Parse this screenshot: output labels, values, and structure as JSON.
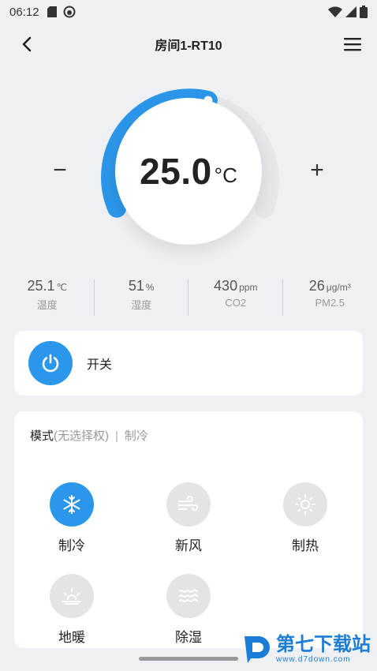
{
  "status_bar": {
    "time": "06:12"
  },
  "header": {
    "title": "房间1-RT10"
  },
  "dial": {
    "setpoint": "25.0",
    "unit": "°C",
    "minus_label": "−",
    "plus_label": "+",
    "arc_color": "#2b97ea"
  },
  "stats": [
    {
      "value": "25.1",
      "unit": "℃",
      "label": "温度"
    },
    {
      "value": "51",
      "unit": "%",
      "label": "湿度"
    },
    {
      "value": "430",
      "unit": "ppm",
      "label": "CO2"
    },
    {
      "value": "26",
      "unit": "μg/m³",
      "label": "PM2.5"
    }
  ],
  "power": {
    "label": "开关",
    "icon": "power-icon"
  },
  "mode": {
    "title": "模式",
    "note": "(无选择权)",
    "separator": "|",
    "current": "制冷",
    "options": [
      {
        "label": "制冷",
        "icon": "snowflake-icon",
        "active": true
      },
      {
        "label": "新风",
        "icon": "wind-icon",
        "active": false
      },
      {
        "label": "制热",
        "icon": "sun-icon",
        "active": false
      },
      {
        "label": "地暖",
        "icon": "floor-heat-icon",
        "active": false
      },
      {
        "label": "除湿",
        "icon": "dehumidify-icon",
        "active": false
      }
    ]
  },
  "watermark": {
    "title": "第七下载站",
    "url": "www.d7down.com"
  },
  "colors": {
    "accent": "#2b97ea",
    "background": "#eef0f3",
    "inactive_circle": "#e3e4e6"
  }
}
